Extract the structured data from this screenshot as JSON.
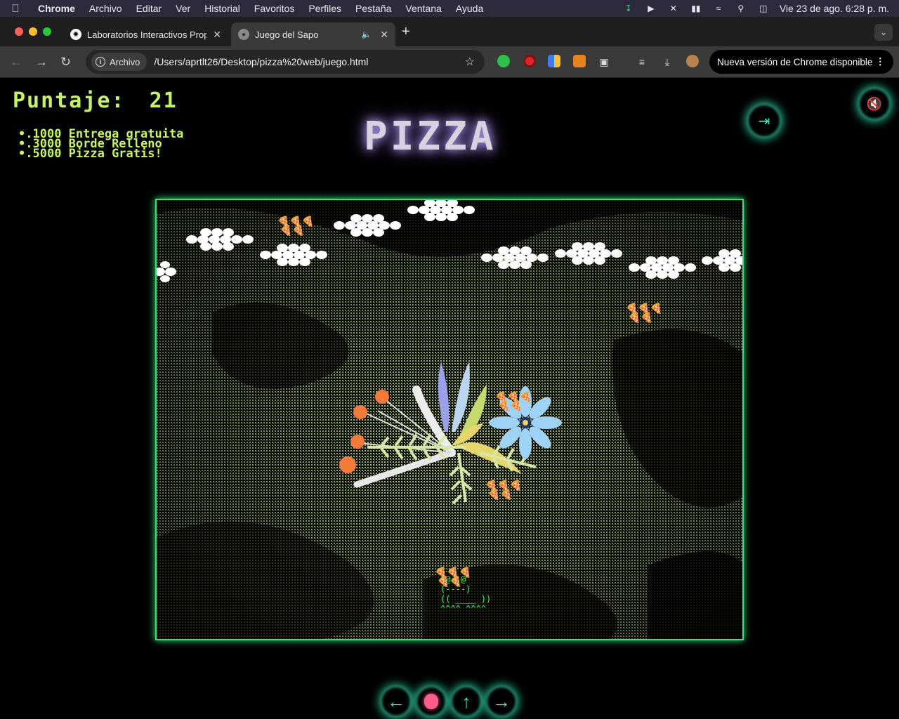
{
  "menubar": {
    "app": "Chrome",
    "items": [
      "Archivo",
      "Editar",
      "Ver",
      "Historial",
      "Favoritos",
      "Perfiles",
      "Pestaña",
      "Ventana",
      "Ayuda"
    ],
    "datetime": "Vie 23 de ago.  6:28 p. m."
  },
  "tabs": [
    {
      "title": "Laboratorios Interactivos Prop",
      "active": false
    },
    {
      "title": "Juego del Sapo",
      "active": true
    }
  ],
  "omnibox": {
    "chip": "Archivo",
    "url": "/Users/aprtlt26/Desktop/pizza%20web/juego.html"
  },
  "update_pill": "Nueva versión de Chrome disponible",
  "game": {
    "score_label": "Puntaje:",
    "score_value": "21",
    "prizes": [
      ".1000 Entrega gratuita",
      ".3000 Borde Relleno",
      ".5000 Pizza Gratis!"
    ],
    "logo": "PIZZA",
    "frog_art": " @..@\n(----)\n(( ____ ))\n^^^^ ^^^^"
  },
  "icons": {
    "sound": "speaker-muted-icon",
    "exit": "exit-icon",
    "left": "arrow-left-icon",
    "tongue": "tongue-icon",
    "up": "arrow-up-icon",
    "right": "arrow-right-icon"
  },
  "colors": {
    "score": "#c6f26a",
    "neon": "#30e6b2",
    "frame": "#39e07a",
    "frog": "#39ff4a"
  }
}
